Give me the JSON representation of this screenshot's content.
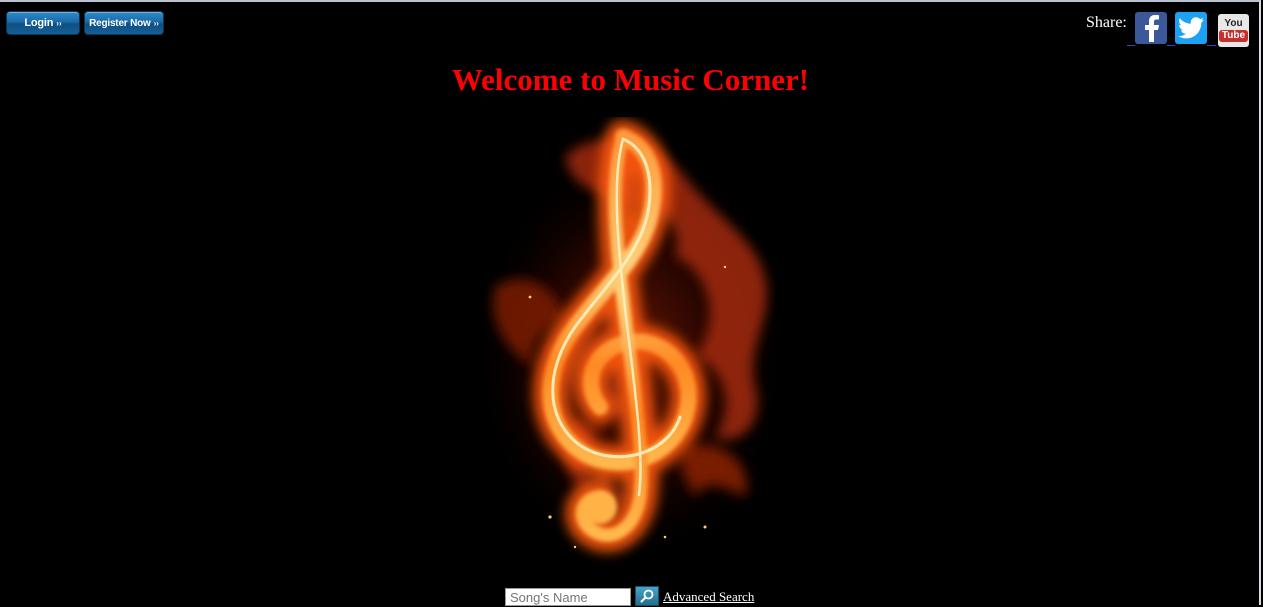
{
  "header": {
    "login_label": "Login",
    "register_label": "Register Now",
    "chevron": "››",
    "share_label": "Share:",
    "social": [
      {
        "name": "facebook-icon",
        "glyph": "f"
      },
      {
        "name": "twitter-icon",
        "glyph": "bird"
      },
      {
        "name": "youtube-icon",
        "top": "You",
        "bottom": "Tube"
      }
    ]
  },
  "main": {
    "title": "Welcome to Music Corner!",
    "hero_image": "fire-treble-clef"
  },
  "search": {
    "placeholder": "Song's Name",
    "button_icon": "search-icon",
    "advanced_label": "Advanced Search"
  },
  "colors": {
    "background": "#000000",
    "title": "#ff0000",
    "button": "#1a6aa7",
    "facebook": "#3b5998",
    "twitter": "#1da1f2",
    "youtube": "#c4302b"
  }
}
